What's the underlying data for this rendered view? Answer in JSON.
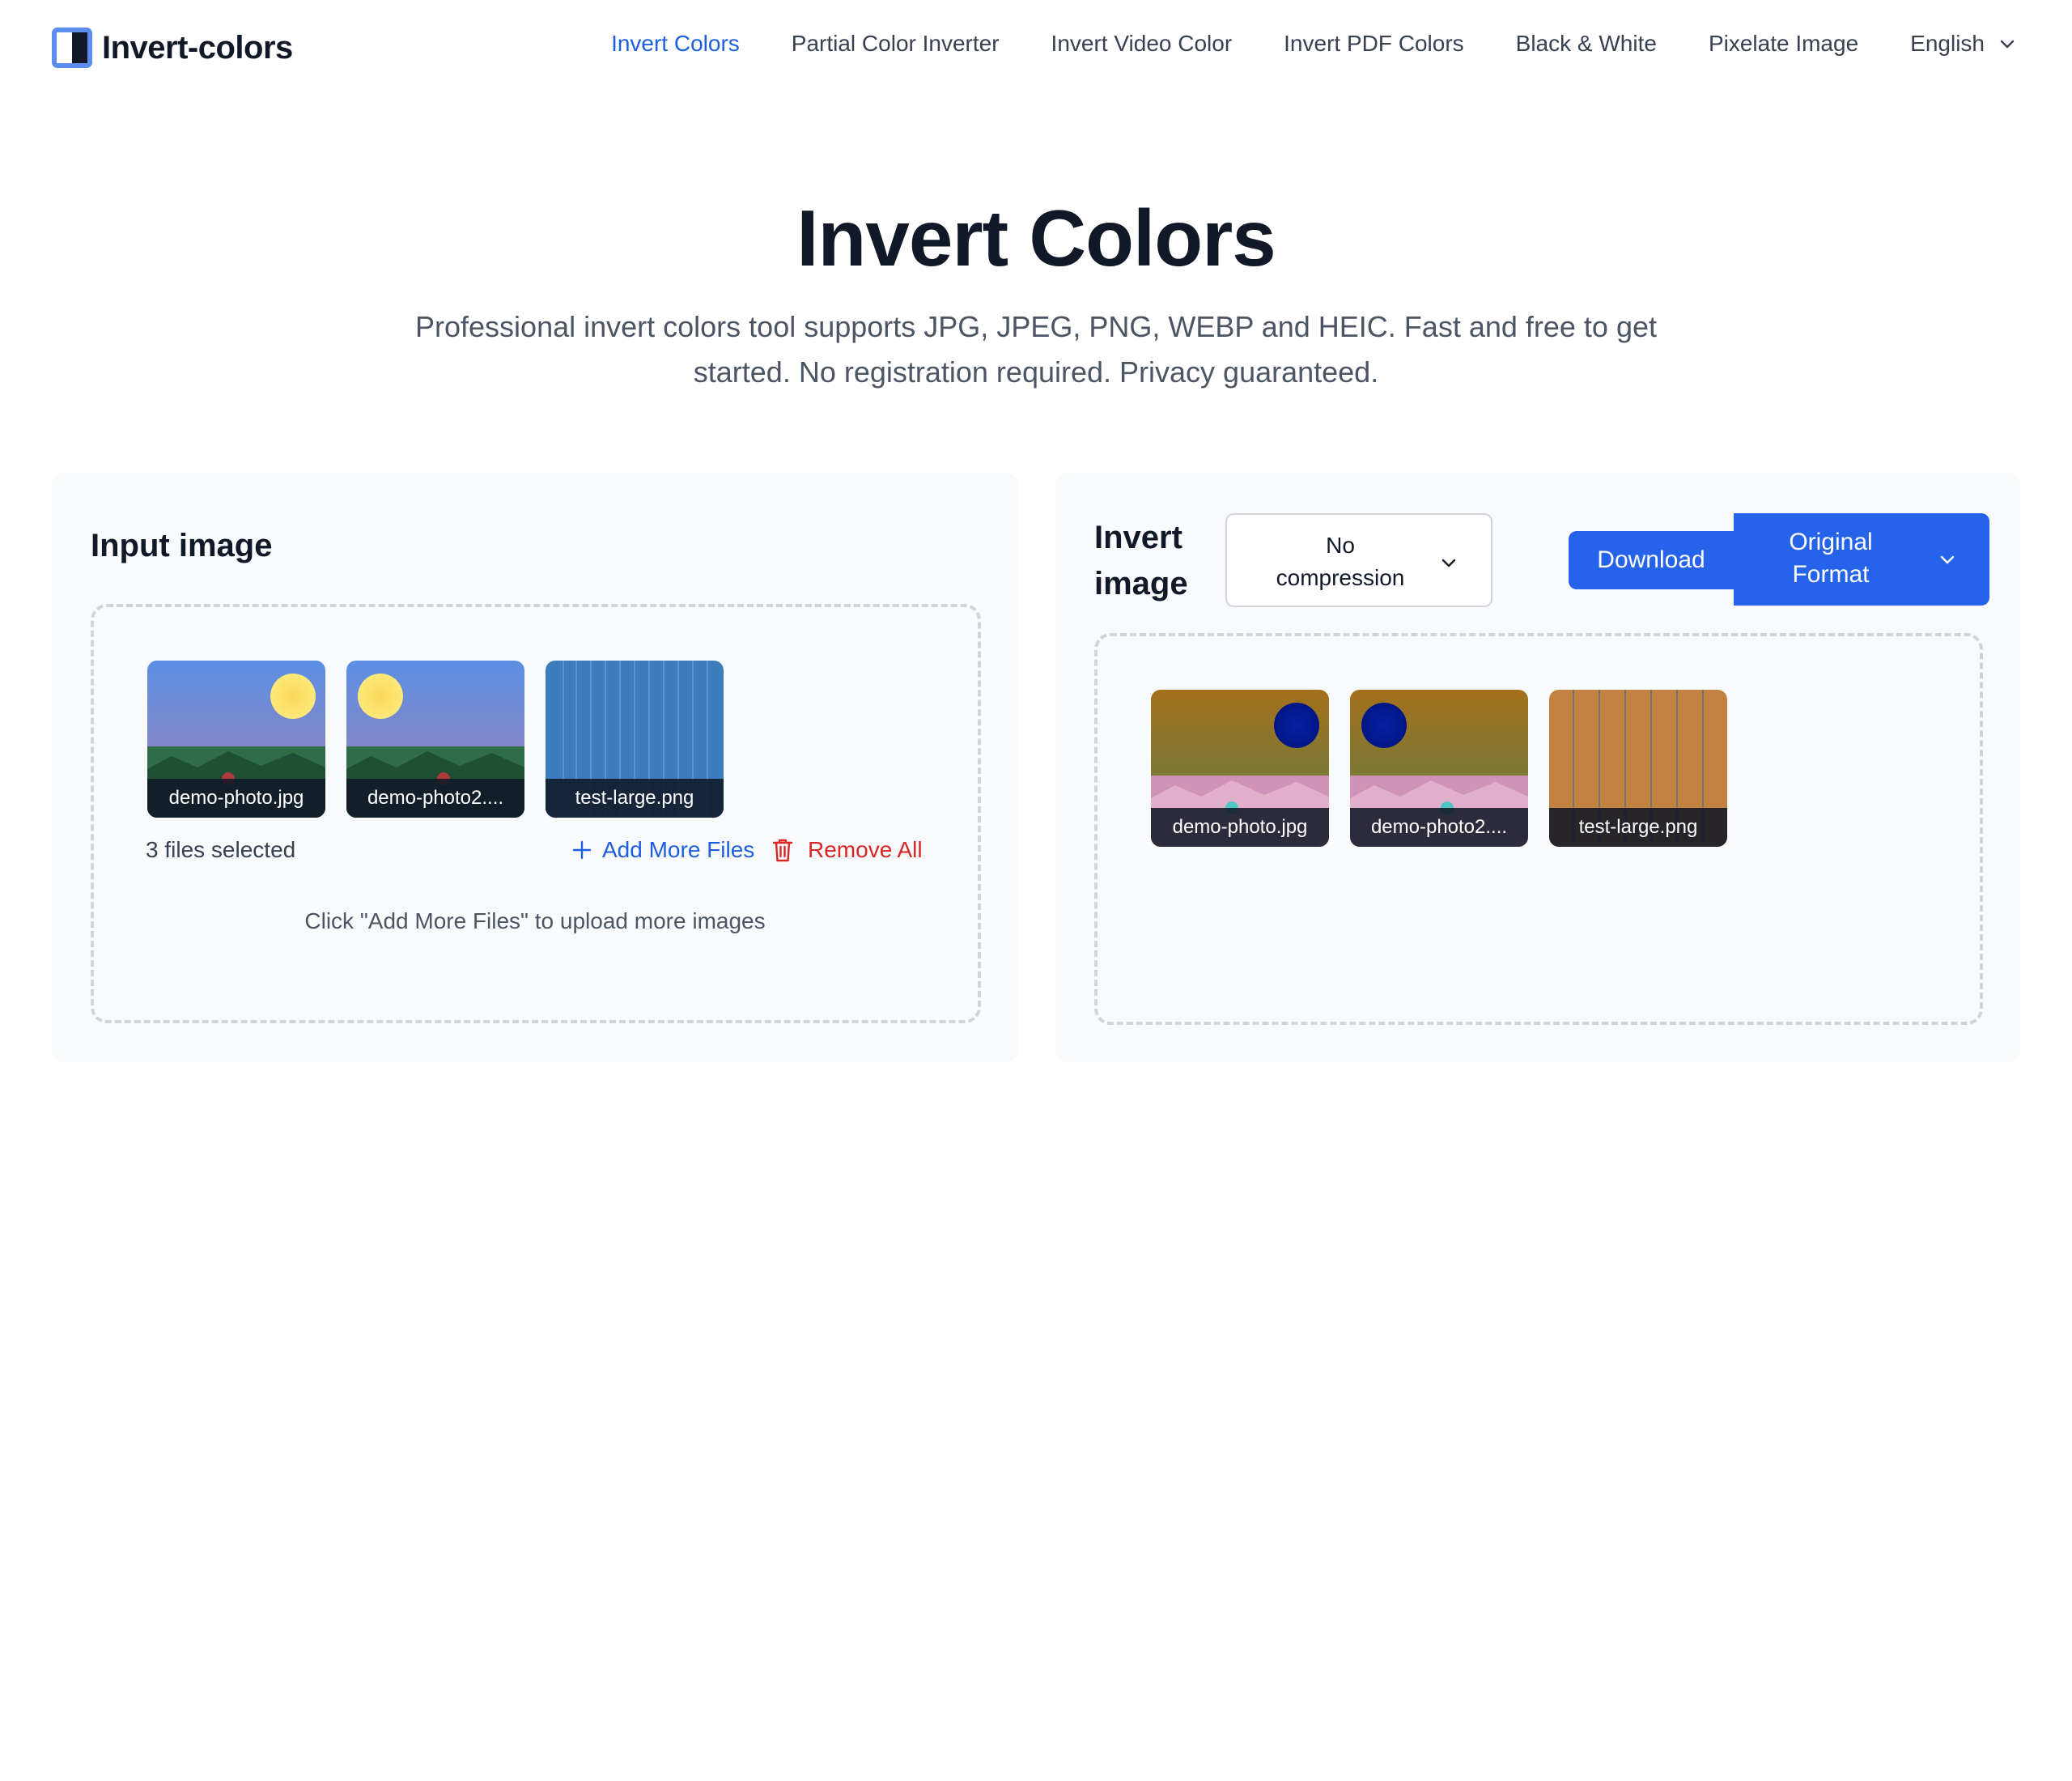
{
  "header": {
    "logo_text": "Invert-colors",
    "nav": [
      {
        "label": "Invert Colors",
        "active": true
      },
      {
        "label": "Partial Color Inverter",
        "active": false
      },
      {
        "label": "Invert Video Color",
        "active": false
      },
      {
        "label": "Invert PDF Colors",
        "active": false
      },
      {
        "label": "Black & White",
        "active": false
      },
      {
        "label": "Pixelate Image",
        "active": false
      }
    ],
    "language": "English"
  },
  "hero": {
    "title": "Invert Colors",
    "subtitle": "Professional invert colors tool supports JPG, JPEG, PNG, WEBP and HEIC. Fast and free to get started. No registration required. Privacy guaranteed."
  },
  "input_panel": {
    "title": "Input image",
    "files": [
      {
        "name": "demo-photo.jpg"
      },
      {
        "name": "demo-photo2...."
      },
      {
        "name": "test-large.png"
      }
    ],
    "files_selected": "3 files selected",
    "add_more_label": "Add More Files",
    "remove_all_label": "Remove All",
    "hint": "Click \"Add More Files\" to upload more images"
  },
  "output_panel": {
    "title_line1": "Invert",
    "title_line2": "image",
    "compression_line1": "No",
    "compression_line2": "compression",
    "download_label": "Download",
    "format_line1": "Original",
    "format_line2": "Format",
    "files": [
      {
        "name": "demo-photo.jpg"
      },
      {
        "name": "demo-photo2...."
      },
      {
        "name": "test-large.png"
      }
    ]
  },
  "colors": {
    "accent": "#2563eb",
    "active_link": "#1d5fe0",
    "danger": "#dc2626",
    "panel_bg": "#f8fafc",
    "heading": "#111827"
  },
  "icons": {
    "logo": "half-filled-square-icon",
    "language": "chevron-down-icon",
    "add": "plus-icon",
    "remove": "trash-icon",
    "select": "chevron-down-icon"
  }
}
